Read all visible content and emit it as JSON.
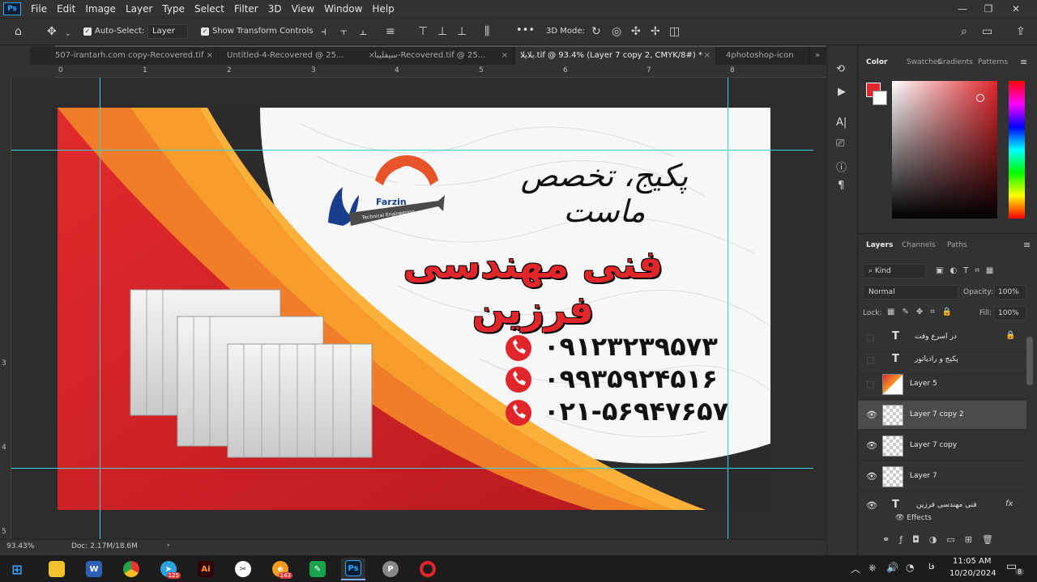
{
  "menu": [
    "File",
    "Edit",
    "Image",
    "Layer",
    "Type",
    "Select",
    "Filter",
    "3D",
    "View",
    "Window",
    "Help"
  ],
  "options_bar": {
    "auto_select_label": "Auto-Select:",
    "auto_select_value": "Layer",
    "show_transform_label": "Show Transform Controls",
    "mode_3d_label": "3D Mode:",
    "more": "•••"
  },
  "tabs": [
    {
      "label": "507-irantarh.com copy-Recovered.tif"
    },
    {
      "label": "Untitled-4-Recovered @ 25..."
    },
    {
      "label": "سیفلیبا-Recovered.tif @ 25..."
    },
    {
      "label": "بلایلا.tif @ 93.4% (Layer 7 copy 2, CMYK/8#) *"
    },
    {
      "label": "4photoshop-icon"
    }
  ],
  "ruler_top": [
    "0",
    "1",
    "2",
    "3",
    "4",
    "5",
    "6",
    "7",
    "8"
  ],
  "ruler_left": [
    "3",
    "4",
    "5"
  ],
  "card": {
    "tagline": "پکیج، تخصص ماست",
    "company": "فنی مهندسی فرزین",
    "logo_brand": "Farzin",
    "logo_sub": "Technical Engineering",
    "phones": [
      "۰۹۱۲۳۲۳۹۵۷۳",
      "۰۹۹۳۵۹۲۴۵۱۶",
      "۰۲۱-۵۶۹۴۷۶۵۷"
    ]
  },
  "status": {
    "zoom": "93.43%",
    "doc": "Doc: 2.17M/18.6M"
  },
  "color_panel": {
    "tabs": [
      "Color",
      "Swatches",
      "Gradients",
      "Patterns"
    ],
    "foreground": "#e0262b",
    "background": "#ffffff"
  },
  "layers_panel": {
    "tabs": [
      "Layers",
      "Channels",
      "Paths"
    ],
    "filter_kind": "Kind",
    "blend_mode": "Normal",
    "opacity_label": "Opacity:",
    "opacity": "100%",
    "lock_label": "Lock:",
    "fill_label": "Fill:",
    "fill": "100%",
    "layers": [
      {
        "name": "در اسرع وقت",
        "type": "text",
        "visible": false,
        "locked": true
      },
      {
        "name": "پکیج و رادیاتور",
        "type": "text",
        "visible": false
      },
      {
        "name": "Layer 5",
        "type": "image",
        "visible": false
      },
      {
        "name": "Layer 7 copy 2",
        "type": "image",
        "visible": true,
        "selected": true
      },
      {
        "name": "Layer 7 copy",
        "type": "image",
        "visible": true
      },
      {
        "name": "Layer 7",
        "type": "image",
        "visible": true
      },
      {
        "name": "فنی مهندسی فرزین",
        "type": "text",
        "visible": true,
        "fx": true
      }
    ],
    "effects_label": "Effects"
  },
  "taskbar": {
    "time": "11:05 AM",
    "date": "10/20/2024",
    "lang": "فا",
    "notifications": "8",
    "telegram_badge": "125",
    "app_badge": "143"
  }
}
